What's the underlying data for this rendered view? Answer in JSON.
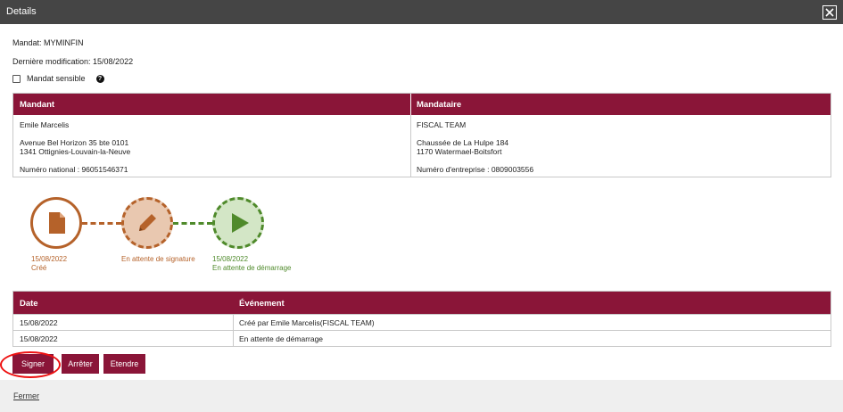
{
  "window": {
    "title": "Details"
  },
  "mandat": {
    "line": "Mandat: MYMINFIN",
    "modified": "Dernière modification: 15/08/2022",
    "sensible_label": "Mandat sensible",
    "sensible_checked": false
  },
  "parties": {
    "headers": {
      "mandant": "Mandant",
      "mandataire": "Mandataire"
    },
    "mandant": {
      "name": "Emile Marcelis",
      "address1": "Avenue Bel Horizon 35 bte 0101",
      "address2": "1341 Ottignies-Louvain-la-Neuve",
      "id_line": "Numéro national : 96051546371"
    },
    "mandataire": {
      "name": "FISCAL TEAM",
      "address1": "Chaussée de La Hulpe 184",
      "address2": "1170 Watermael-Boitsfort",
      "id_line": "Numéro d'entreprise : 0809003556"
    }
  },
  "timeline": [
    {
      "icon": "document-icon",
      "date": "15/08/2022",
      "status": "Créé",
      "color": "#b5622a"
    },
    {
      "icon": "pencil-icon",
      "date": "",
      "status": "En attente de signature",
      "color": "#b5622a"
    },
    {
      "icon": "play-icon",
      "date": "15/08/2022",
      "status": "En attente de démarrage",
      "color": "#4f8a2b"
    }
  ],
  "events": {
    "headers": {
      "date": "Date",
      "event": "Événement"
    },
    "rows": [
      {
        "date": "15/08/2022",
        "event": "Créé par Emile Marcelis(FISCAL TEAM)"
      },
      {
        "date": "15/08/2022",
        "event": "En attente de démarrage"
      }
    ]
  },
  "actions": {
    "sign": "Signer",
    "stop": "Arrêter",
    "extend": "Etendre"
  },
  "footer": {
    "close": "Fermer"
  },
  "colors": {
    "brand": "#8a1538",
    "titlebar": "#454545",
    "created": "#b5622a",
    "pending_sig": "#e9c8b0",
    "started": "#4f8a2b",
    "started_bg": "#d3e6c6"
  }
}
